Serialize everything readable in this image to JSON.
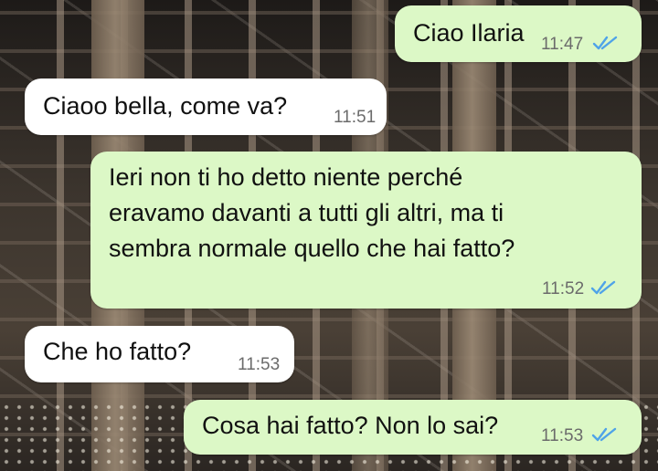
{
  "chat": {
    "messages": [
      {
        "direction": "outgoing",
        "lines": [
          "Ciao Ilaria"
        ],
        "time": "11:47",
        "status": "read"
      },
      {
        "direction": "incoming",
        "lines": [
          "Ciaoo bella, come va?"
        ],
        "time": "11:51"
      },
      {
        "direction": "outgoing",
        "lines": [
          "Ieri non ti ho detto niente perché",
          "eravamo davanti a tutti gli altri, ma ti",
          "sembra normale quello che hai fatto?"
        ],
        "time": "11:52",
        "status": "read"
      },
      {
        "direction": "incoming",
        "lines": [
          "Che ho fatto?"
        ],
        "time": "11:53"
      },
      {
        "direction": "outgoing",
        "lines": [
          "Cosa hai fatto? Non lo sai?"
        ],
        "time": "11:53",
        "status": "read"
      }
    ]
  },
  "colors": {
    "outgoing_bubble": "#dcf8c6",
    "incoming_bubble": "#ffffff",
    "read_ticks": "#4fa3e8",
    "timestamp": "#6b6b6b"
  },
  "icons": {
    "read_receipt": "double-check-icon"
  }
}
